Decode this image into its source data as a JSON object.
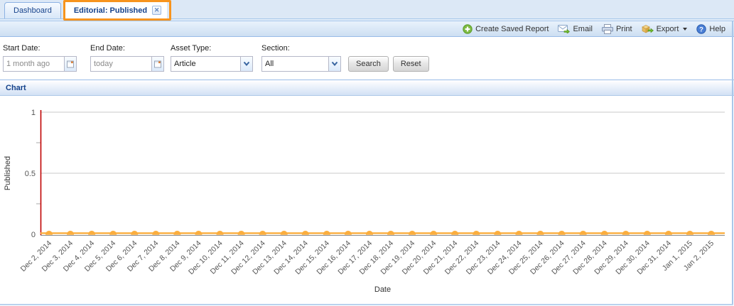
{
  "tabs": {
    "dashboard": {
      "label": "Dashboard"
    },
    "editorial": {
      "label": "Editorial: Published",
      "close_label": "x",
      "highlighted": true
    }
  },
  "toolbar": {
    "items": [
      {
        "icon": "add-icon",
        "label": "Create Saved Report"
      },
      {
        "icon": "email-icon",
        "label": "Email"
      },
      {
        "icon": "print-icon",
        "label": "Print"
      },
      {
        "icon": "export-icon",
        "label": "Export",
        "has_menu": true
      },
      {
        "icon": "help-icon",
        "label": "Help"
      }
    ]
  },
  "filters": {
    "start_date": {
      "label": "Start Date:",
      "value": "1 month ago"
    },
    "end_date": {
      "label": "End Date:",
      "value": "today"
    },
    "asset_type": {
      "label": "Asset Type:",
      "value": "Article"
    },
    "section": {
      "label": "Section:",
      "value": "All"
    },
    "search_label": "Search",
    "reset_label": "Reset"
  },
  "panel": {
    "title": "Chart"
  },
  "colors": {
    "highlight_box": "#f7941e",
    "tab_text": "#15428b",
    "panel_border": "#99bbe8"
  },
  "chart_data": {
    "type": "line",
    "title": "",
    "xlabel": "Date",
    "ylabel": "Published",
    "x": [
      "Dec 2, 2014",
      "Dec 3, 2014",
      "Dec 4, 2014",
      "Dec 5, 2014",
      "Dec 6, 2014",
      "Dec 7, 2014",
      "Dec 8, 2014",
      "Dec 9, 2014",
      "Dec 10, 2014",
      "Dec 11, 2014",
      "Dec 12, 2014",
      "Dec 13, 2014",
      "Dec 14, 2014",
      "Dec 15, 2014",
      "Dec 16, 2014",
      "Dec 17, 2014",
      "Dec 18, 2014",
      "Dec 19, 2014",
      "Dec 20, 2014",
      "Dec 21, 2014",
      "Dec 22, 2014",
      "Dec 23, 2014",
      "Dec 24, 2014",
      "Dec 25, 2014",
      "Dec 26, 2014",
      "Dec 27, 2014",
      "Dec 28, 2014",
      "Dec 29, 2014",
      "Dec 30, 2014",
      "Dec 31, 2014",
      "Jan 1, 2015",
      "Jan 2, 2015"
    ],
    "values": [
      0,
      0,
      0,
      0,
      0,
      0,
      0,
      0,
      0,
      0,
      0,
      0,
      0,
      0,
      0,
      0,
      0,
      0,
      0,
      0,
      0,
      0,
      0,
      0,
      0,
      0,
      0,
      0,
      0,
      0,
      0,
      0
    ],
    "ylim": [
      0,
      1
    ],
    "yticks": [
      0,
      0.5,
      1
    ],
    "minor_yticks": [
      0.25,
      0.75
    ],
    "grid": true,
    "legend": "none",
    "marker": "circle",
    "colors": {
      "series": "#fbae3e",
      "y_axis": "#bf0000",
      "x_axis": "#8a8a8a",
      "gridline": "#c9c9c9",
      "tick_label": "#555555",
      "axis_title": "#333333"
    }
  }
}
